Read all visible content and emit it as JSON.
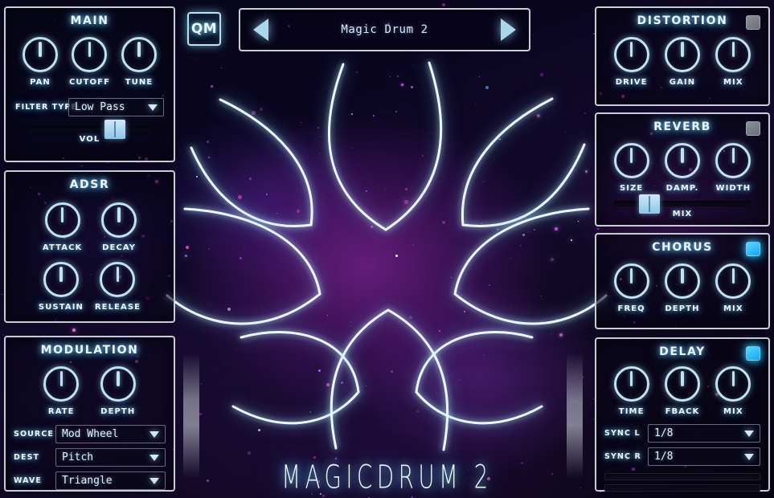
{
  "window": {
    "title": "MAGICDRUM 2",
    "logo_text": "QM"
  },
  "colors": {
    "accent": "#bfe4f2",
    "glow": "#7fd8ff",
    "toggle_on": "#35c4ff",
    "toggle_off": "#8d8f98",
    "panel_border": "#c9cdd6"
  },
  "preset": {
    "prev_icon": "triangle-left-icon",
    "next_icon": "triangle-right-icon",
    "name": "Magic Drum 2"
  },
  "panels": {
    "main": {
      "title": "MAIN",
      "knobs": [
        {
          "label": "PAN",
          "value": 50
        },
        {
          "label": "CUTOFF",
          "value": 50
        },
        {
          "label": "TUNE",
          "value": 50
        }
      ],
      "filter_type": {
        "label": "FILTER TYPE",
        "value": "Low Pass"
      },
      "vol": {
        "label": "VOL",
        "value": 70
      }
    },
    "adsr": {
      "title": "ADSR",
      "knobs": [
        {
          "label": "ATTACK",
          "value": 50
        },
        {
          "label": "DECAY",
          "value": 50
        },
        {
          "label": "SUSTAIN",
          "value": 50
        },
        {
          "label": "RELEASE",
          "value": 50
        }
      ]
    },
    "modulation": {
      "title": "MODULATION",
      "knobs": [
        {
          "label": "RATE",
          "value": 50
        },
        {
          "label": "DEPTH",
          "value": 50
        }
      ],
      "source": {
        "label": "SOURCE",
        "value": "Mod Wheel"
      },
      "dest": {
        "label": "DEST",
        "value": "Pitch"
      },
      "wave": {
        "label": "WAVE",
        "value": "Triangle"
      }
    },
    "distortion": {
      "title": "DISTORTION",
      "enabled": false,
      "knobs": [
        {
          "label": "DRIVE",
          "value": 50
        },
        {
          "label": "GAIN",
          "value": 50
        },
        {
          "label": "MIX",
          "value": 50
        }
      ]
    },
    "reverb": {
      "title": "REVERB",
      "enabled": false,
      "knobs": [
        {
          "label": "SIZE",
          "value": 50
        },
        {
          "label": "DAMP.",
          "value": 50
        },
        {
          "label": "WIDTH",
          "value": 50
        }
      ],
      "mix": {
        "label": "MIX",
        "value": 26
      }
    },
    "chorus": {
      "title": "CHORUS",
      "enabled": true,
      "knobs": [
        {
          "label": "FREQ",
          "value": 50
        },
        {
          "label": "DEPTH",
          "value": 50
        },
        {
          "label": "MIX",
          "value": 50
        }
      ]
    },
    "delay": {
      "title": "DELAY",
      "enabled": true,
      "knobs": [
        {
          "label": "TIME",
          "value": 50
        },
        {
          "label": "FBACK",
          "value": 50
        },
        {
          "label": "MIX",
          "value": 50
        }
      ],
      "sync_l": {
        "label": "SYNC L",
        "value": "1/8"
      },
      "sync_r": {
        "label": "SYNC R",
        "value": "1/8"
      }
    }
  }
}
